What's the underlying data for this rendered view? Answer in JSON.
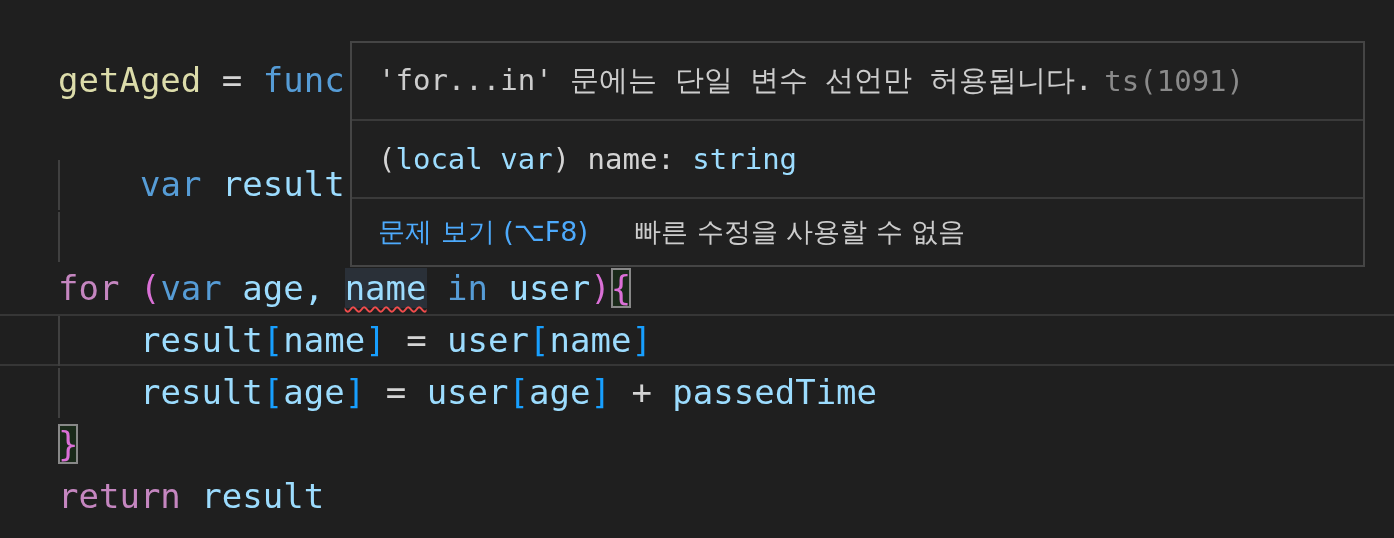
{
  "editor": {
    "lines": [
      {
        "guide": false,
        "indented": false,
        "current": false,
        "tokens": [
          {
            "text": "getAged",
            "kind": "function"
          },
          {
            "text": " = ",
            "kind": "plain"
          },
          {
            "text": "func",
            "kind": "keyword"
          }
        ]
      },
      {
        "guide": false,
        "current": false
      },
      {
        "guide": true,
        "indented": true,
        "current": false,
        "tokens": [
          {
            "text": "var ",
            "kind": "keyword"
          },
          {
            "text": "result",
            "kind": "variable"
          }
        ]
      },
      {
        "guide": true,
        "current": false
      },
      {
        "guide": false,
        "indented": false,
        "current": false,
        "tokens": [
          {
            "text": "for ",
            "kind": "control"
          },
          {
            "text": "(",
            "kind": "paren"
          },
          {
            "text": "var",
            "kind": "keyword"
          },
          {
            "text": " age, ",
            "kind": "variable"
          },
          {
            "text": "name",
            "kind": "variable",
            "error": true
          },
          {
            "text": " in",
            "kind": "keyword"
          },
          {
            "text": " user",
            "kind": "variable"
          },
          {
            "text": ")",
            "kind": "paren"
          },
          {
            "text": "{",
            "kind": "paren",
            "matched": true
          }
        ]
      },
      {
        "guide": true,
        "indented": true,
        "current": true,
        "tokens": [
          {
            "text": "result",
            "kind": "variable"
          },
          {
            "text": "[",
            "kind": "bracket"
          },
          {
            "text": "name",
            "kind": "variable"
          },
          {
            "text": "]",
            "kind": "bracket"
          },
          {
            "text": " = ",
            "kind": "plain"
          },
          {
            "text": "user",
            "kind": "variable"
          },
          {
            "text": "[",
            "kind": "bracket"
          },
          {
            "text": "name",
            "kind": "variable"
          },
          {
            "text": "]",
            "kind": "bracket"
          }
        ]
      },
      {
        "guide": true,
        "indented": true,
        "current": false,
        "tokens": [
          {
            "text": "result",
            "kind": "variable"
          },
          {
            "text": "[",
            "kind": "bracket"
          },
          {
            "text": "age",
            "kind": "variable"
          },
          {
            "text": "]",
            "kind": "bracket"
          },
          {
            "text": " = ",
            "kind": "plain"
          },
          {
            "text": "user",
            "kind": "variable"
          },
          {
            "text": "[",
            "kind": "bracket"
          },
          {
            "text": "age",
            "kind": "variable"
          },
          {
            "text": "]",
            "kind": "bracket"
          },
          {
            "text": " + ",
            "kind": "plain"
          },
          {
            "text": "passedTime",
            "kind": "variable"
          }
        ]
      },
      {
        "guide": false,
        "indented": false,
        "current": false,
        "tokens": [
          {
            "text": "}",
            "kind": "paren",
            "matched": true
          }
        ]
      },
      {
        "guide": false,
        "indented": false,
        "current": false,
        "tokens": [
          {
            "text": "return ",
            "kind": "control"
          },
          {
            "text": "result",
            "kind": "variable"
          }
        ]
      }
    ]
  },
  "hover": {
    "message": "'for...in' 문에는 단일 변수 선언만 허용됩니다.",
    "code": "ts(1091)",
    "signature": [
      {
        "text": "(",
        "kind": "plain"
      },
      {
        "text": "local var",
        "kind": "variable"
      },
      {
        "text": ") name: ",
        "kind": "plain"
      },
      {
        "text": "string",
        "kind": "variable"
      }
    ],
    "view_problem_link": "문제 보기 (⌥F8)",
    "quick_fix_status": "빠른 수정을 사용할 수 없음"
  }
}
